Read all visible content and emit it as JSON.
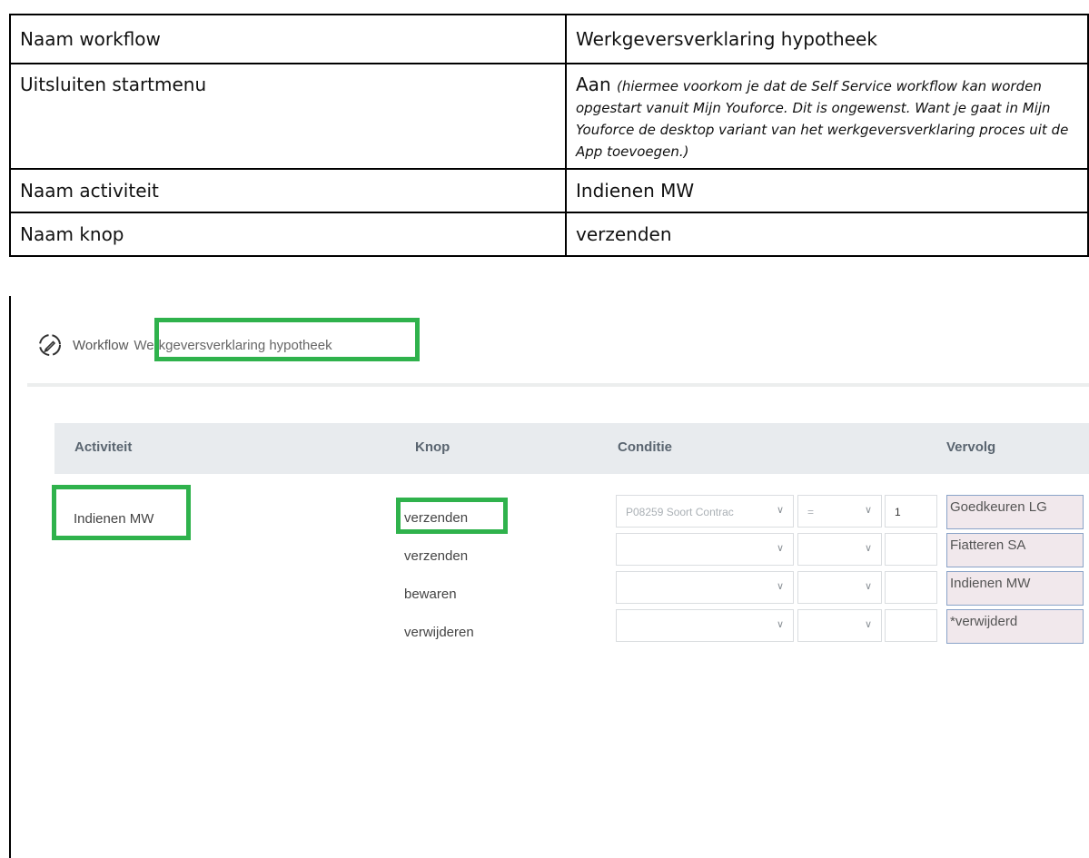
{
  "info_table": {
    "rows": [
      {
        "label": "Naam workflow",
        "value": "Werkgeversverklaring hypotheek"
      },
      {
        "label": "Uitsluiten startmenu",
        "value": "Aan",
        "note": "(hiermee voorkom je dat de Self Service workflow kan worden opgestart vanuit Mijn Youforce. Dit is ongewenst. Want je gaat in Mijn Youforce de desktop variant van het werkgeversverklaring proces uit de App toevoegen.)"
      },
      {
        "label": "Naam activiteit",
        "value": "Indienen MW"
      },
      {
        "label": "Naam knop",
        "value": "verzenden"
      }
    ]
  },
  "screenshot": {
    "breadcrumb": {
      "section": "Workflow",
      "title": "Werkgeversverklaring hypotheek"
    },
    "table": {
      "headers": {
        "activity": "Activiteit",
        "button": "Knop",
        "condition": "Conditie",
        "next": "Vervolg"
      },
      "activity": "Indienen MW",
      "rows": [
        {
          "button": "verzenden",
          "condition": "P08259 Soort Contrac",
          "operator": "=",
          "value": "1",
          "next": "Goedkeuren LG"
        },
        {
          "button": "verzenden",
          "condition": "",
          "operator": "",
          "value": "",
          "next": "Fiatteren SA"
        },
        {
          "button": "bewaren",
          "condition": "",
          "operator": "",
          "value": "",
          "next": "Indienen MW"
        },
        {
          "button": "verwijderen",
          "condition": "",
          "operator": "",
          "value": "",
          "next": "*verwijderd"
        }
      ]
    },
    "icons": {
      "workflow": "workflow-icon",
      "chevron": "chevron-down-icon"
    },
    "colors": {
      "highlight": "#2fb24c",
      "header_bg": "#e8ebee",
      "next_bg": "#f1e8ec"
    }
  }
}
